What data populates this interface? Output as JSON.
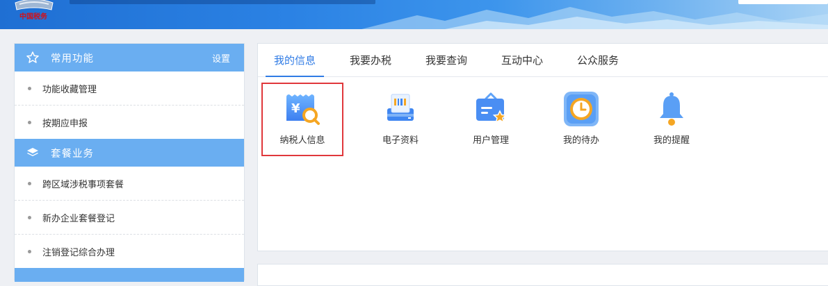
{
  "header": {
    "logo_text": "中国税务"
  },
  "sidebar": {
    "sections": [
      {
        "title": "常用功能",
        "setting_label": "设置",
        "items": [
          "功能收藏管理",
          "按期应申报"
        ]
      },
      {
        "title": "套餐业务",
        "items": [
          "跨区域涉税事项套餐",
          "新办企业套餐登记",
          "注销登记综合办理"
        ]
      }
    ]
  },
  "main": {
    "tabs": [
      "我的信息",
      "我要办税",
      "我要查询",
      "互动中心",
      "公众服务"
    ],
    "active_tab": "我的信息",
    "tiles": [
      {
        "label": "纳税人信息",
        "icon": "taxpayer-info-icon",
        "highlighted": true
      },
      {
        "label": "电子资料",
        "icon": "electronic-document-icon"
      },
      {
        "label": "用户管理",
        "icon": "user-management-icon"
      },
      {
        "label": "我的待办",
        "icon": "clock-icon"
      },
      {
        "label": "我的提醒",
        "icon": "bell-icon"
      }
    ]
  },
  "colors": {
    "accent": "#2f7be5",
    "sidebar_header": "#6aaef1",
    "highlight_border": "#e0373b"
  }
}
